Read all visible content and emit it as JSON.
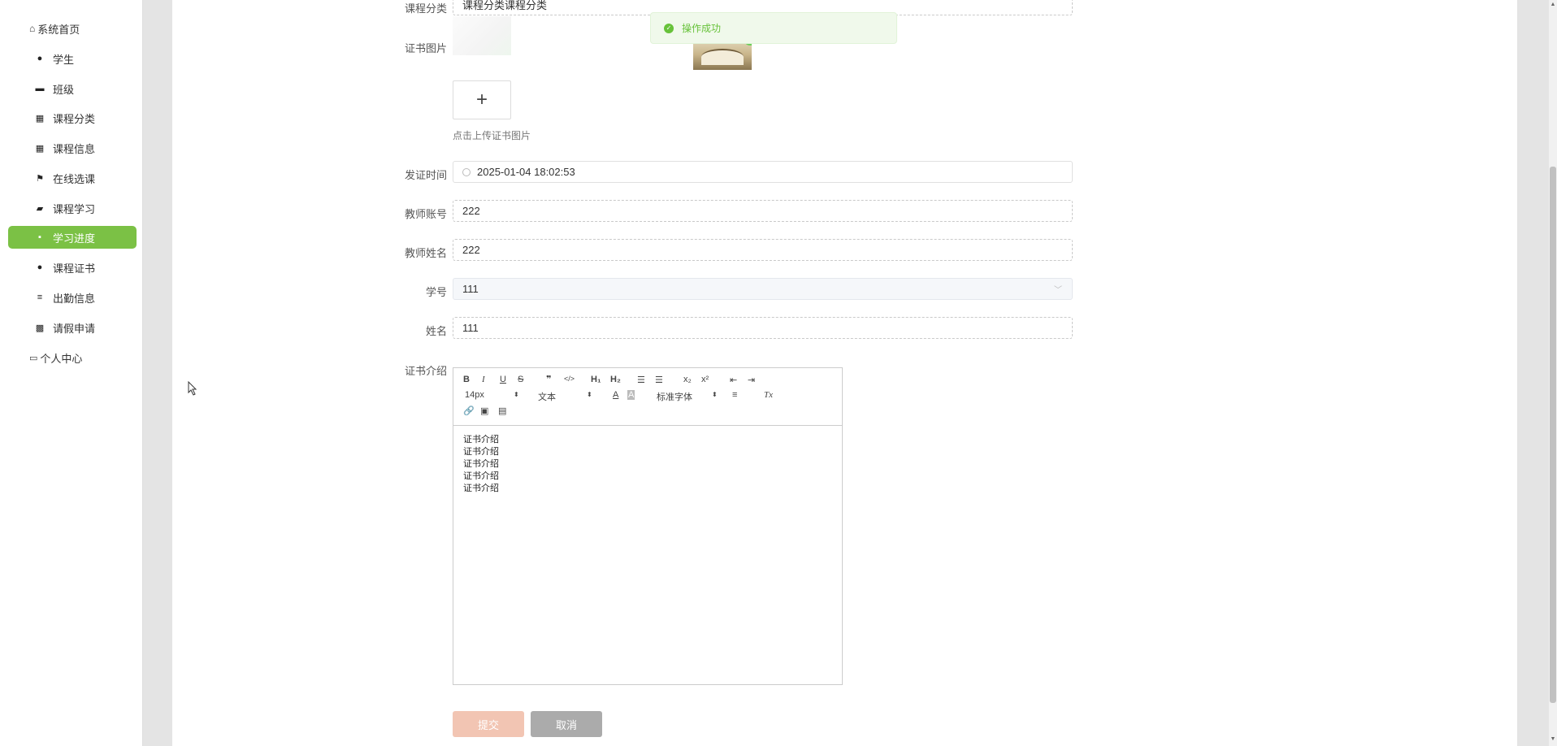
{
  "sidebar": {
    "home": "系统首页",
    "items": [
      {
        "label": "学生",
        "icon": "user-icon"
      },
      {
        "label": "班级",
        "icon": "monitor-icon"
      },
      {
        "label": "课程分类",
        "icon": "grid-icon"
      },
      {
        "label": "课程信息",
        "icon": "grid-icon"
      },
      {
        "label": "在线选课",
        "icon": "flag-icon"
      },
      {
        "label": "课程学习",
        "icon": "briefcase-icon"
      },
      {
        "label": "学习进度",
        "icon": "chat-icon",
        "active": true
      },
      {
        "label": "课程证书",
        "icon": "person-badge-icon"
      },
      {
        "label": "出勤信息",
        "icon": "list-icon"
      },
      {
        "label": "请假申请",
        "icon": "chart-icon"
      }
    ],
    "profile": "个人中心"
  },
  "toast": {
    "text": "操作成功"
  },
  "form": {
    "category": {
      "label": "课程分类",
      "value": "课程分类课程分类"
    },
    "image": {
      "label": "证书图片",
      "upload_tip": "点击上传证书图片",
      "plus": "+"
    },
    "issue_time": {
      "label": "发证时间",
      "value": "2025-01-04 18:02:53"
    },
    "teacher_account": {
      "label": "教师账号",
      "value": "222"
    },
    "teacher_name": {
      "label": "教师姓名",
      "value": "222"
    },
    "student_no": {
      "label": "学号",
      "value": "111"
    },
    "student_name": {
      "label": "姓名",
      "value": "111"
    },
    "intro": {
      "label": "证书介绍",
      "font_size": "14px",
      "text_style": "文本",
      "font_family": "标准字体",
      "lines": [
        "证书介绍",
        "证书介绍",
        "证书介绍",
        "证书介绍",
        "证书介绍"
      ]
    }
  },
  "buttons": {
    "submit": "提交",
    "cancel": "取消"
  },
  "colors": {
    "accent": "#7bc145",
    "submit": "#f2c5b3",
    "cancel": "#ababab",
    "success": "#67c23a"
  }
}
